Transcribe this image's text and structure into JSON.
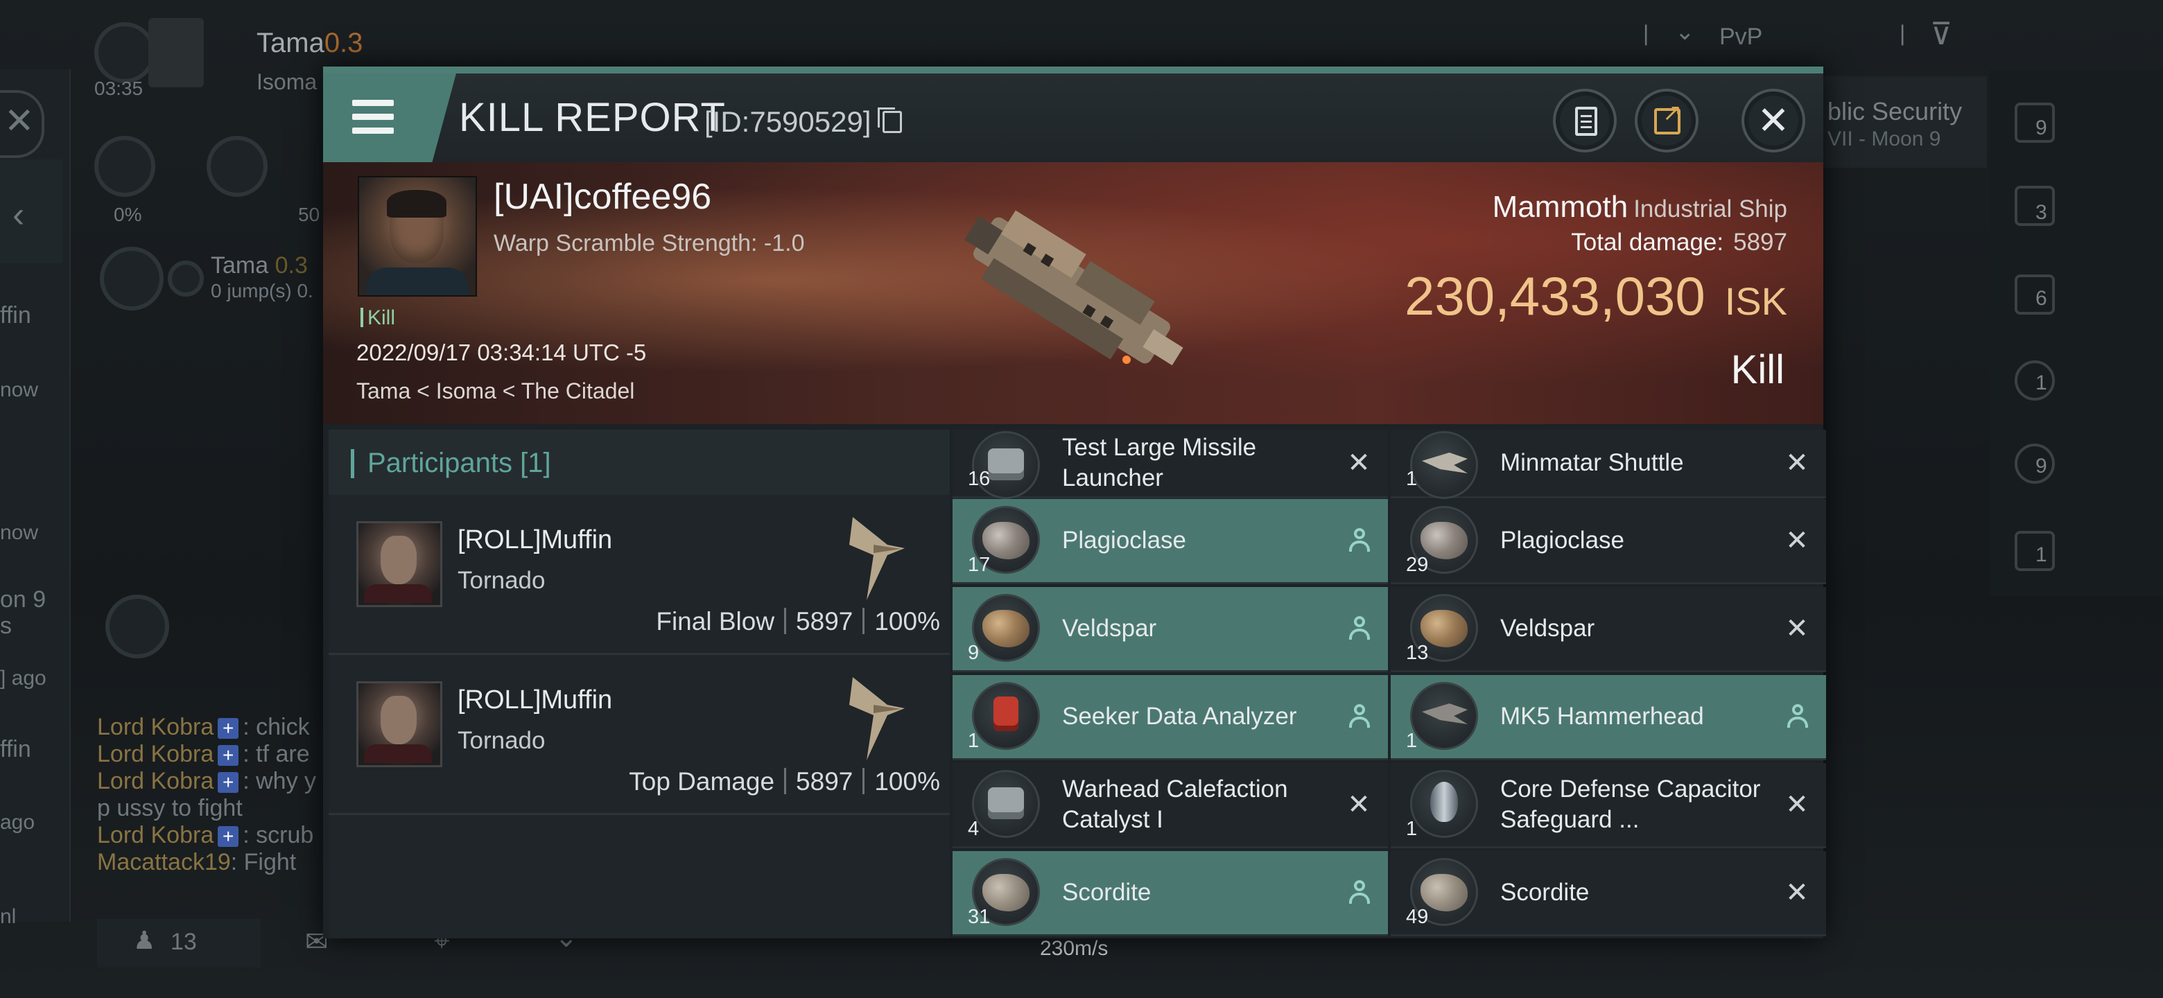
{
  "background": {
    "player_name": "Tama",
    "player_sec": "0.3",
    "player_time": "03:35",
    "player_system": "Isoma",
    "pvp_label": "PvP",
    "security_label": "blic Security",
    "location_fragment": "VII - Moon 9",
    "percent_left": "0%",
    "percent_right": "50",
    "nav_target": "Tama",
    "nav_target_sec": "0.3",
    "nav_jumps": "0 jump(s) 0.",
    "left_labels": [
      "ffin",
      "now",
      "now",
      "on 9",
      "s",
      "] ago",
      "ffin",
      "ago",
      "nl"
    ],
    "chat": [
      {
        "name": "Lord Kobra",
        "text": ": chick"
      },
      {
        "name": "Lord Kobra",
        "text": ": tf are"
      },
      {
        "name": "Lord Kobra",
        "text": ": why y"
      },
      {
        "name": "",
        "text": "p ussy to fight"
      },
      {
        "name": "Lord Kobra",
        "text": ": scrub"
      },
      {
        "name": "Macattack19",
        "text": ": Fight"
      }
    ],
    "chat_plus": "+",
    "bottom_count": "13",
    "speed": "230m/s",
    "right_counts": [
      "9",
      "3",
      "6",
      "1",
      "9",
      "1"
    ]
  },
  "header": {
    "title": "KILL REPORT",
    "report_id": "[ID:7590529]"
  },
  "victim": {
    "name": "[UAI]coffee96",
    "warp_scramble": "Warp Scramble Strength: -1.0",
    "kill_badge": "Kill",
    "datetime": "2022/09/17 03:34:14 UTC -5",
    "location": "Tama < Isoma < The Citadel",
    "ship_name": "Mammoth",
    "ship_class": "Industrial Ship",
    "total_damage_label": "Total damage:",
    "total_damage": "5897",
    "isk_value": "230,433,030",
    "isk_unit": "ISK",
    "result": "Kill"
  },
  "participants": {
    "title": "Participants [1]",
    "rows": [
      {
        "name": "[ROLL]Muffin",
        "ship": "Tornado",
        "label": "Final Blow",
        "damage": "5897",
        "percent": "100%"
      },
      {
        "name": "[ROLL]Muffin",
        "ship": "Tornado",
        "label": "Top Damage",
        "damage": "5897",
        "percent": "100%"
      }
    ]
  },
  "items": {
    "left": [
      {
        "qty": "16",
        "name": "Test Large Missile Launcher",
        "state": "destroyed"
      },
      {
        "qty": "17",
        "name": "Plagioclase",
        "state": "dropped"
      },
      {
        "qty": "9",
        "name": "Veldspar",
        "state": "dropped"
      },
      {
        "qty": "1",
        "name": "Seeker Data Analyzer",
        "state": "dropped"
      },
      {
        "qty": "4",
        "name": "Warhead Calefaction Catalyst I",
        "state": "destroyed"
      },
      {
        "qty": "31",
        "name": "Scordite",
        "state": "dropped"
      }
    ],
    "right": [
      {
        "qty": "1",
        "name": "Minmatar Shuttle",
        "state": "destroyed"
      },
      {
        "qty": "29",
        "name": "Plagioclase",
        "state": "destroyed"
      },
      {
        "qty": "13",
        "name": "Veldspar",
        "state": "destroyed"
      },
      {
        "qty": "1",
        "name": "MK5 Hammerhead",
        "state": "dropped"
      },
      {
        "qty": "1",
        "name": "Core Defense Capacitor Safeguard ...",
        "state": "destroyed"
      },
      {
        "qty": "49",
        "name": "Scordite",
        "state": "destroyed"
      }
    ],
    "destroyed_glyph": "✕"
  },
  "colors": {
    "accent": "#4a7c73",
    "dropped_row": "#4a7870",
    "isk": "#f0c48a",
    "participants_title": "#5fa69a"
  }
}
